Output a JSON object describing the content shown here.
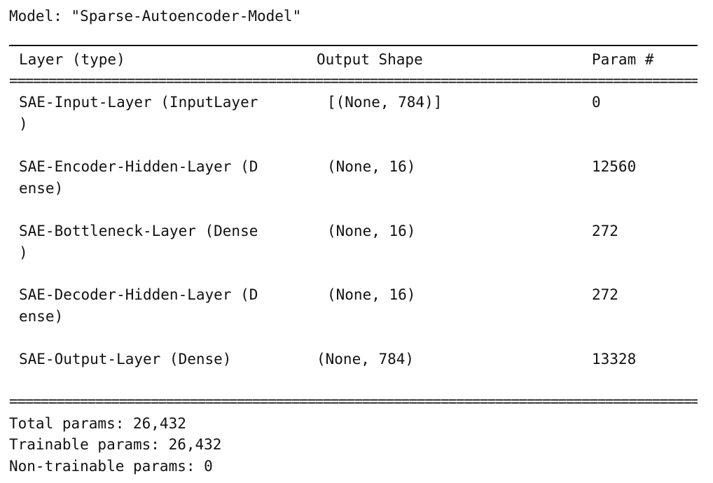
{
  "model": {
    "title": "Model: \"Sparse-Autoencoder-Model\""
  },
  "table": {
    "headers": [
      "Layer (type)",
      "Output Shape",
      "Param #"
    ],
    "separator": "==================================================================================================",
    "rows": [
      {
        "layer_line1": "SAE-Input-Layer (InputLayer",
        "layer_line2": ")",
        "output_shape": "[(None, 784)]",
        "params": "0"
      },
      {
        "layer_line1": "SAE-Encoder-Hidden-Layer (D",
        "layer_line2": "ense)",
        "output_shape": "(None, 16)",
        "params": "12560"
      },
      {
        "layer_line1": "SAE-Bottleneck-Layer (Dense",
        "layer_line2": ")",
        "output_shape": "(None, 16)",
        "params": "272"
      },
      {
        "layer_line1": "SAE-Decoder-Hidden-Layer (D",
        "layer_line2": "ense)",
        "output_shape": "(None, 16)",
        "params": "272"
      },
      {
        "layer_line1": "SAE-Output-Layer (Dense)",
        "layer_line2": "",
        "output_shape": "(None, 784)",
        "params": "13328"
      }
    ]
  },
  "summary": {
    "total": "Total params: 26,432",
    "trainable": "Trainable params: 26,432",
    "non_trainable": "Non-trainable params: 0"
  }
}
